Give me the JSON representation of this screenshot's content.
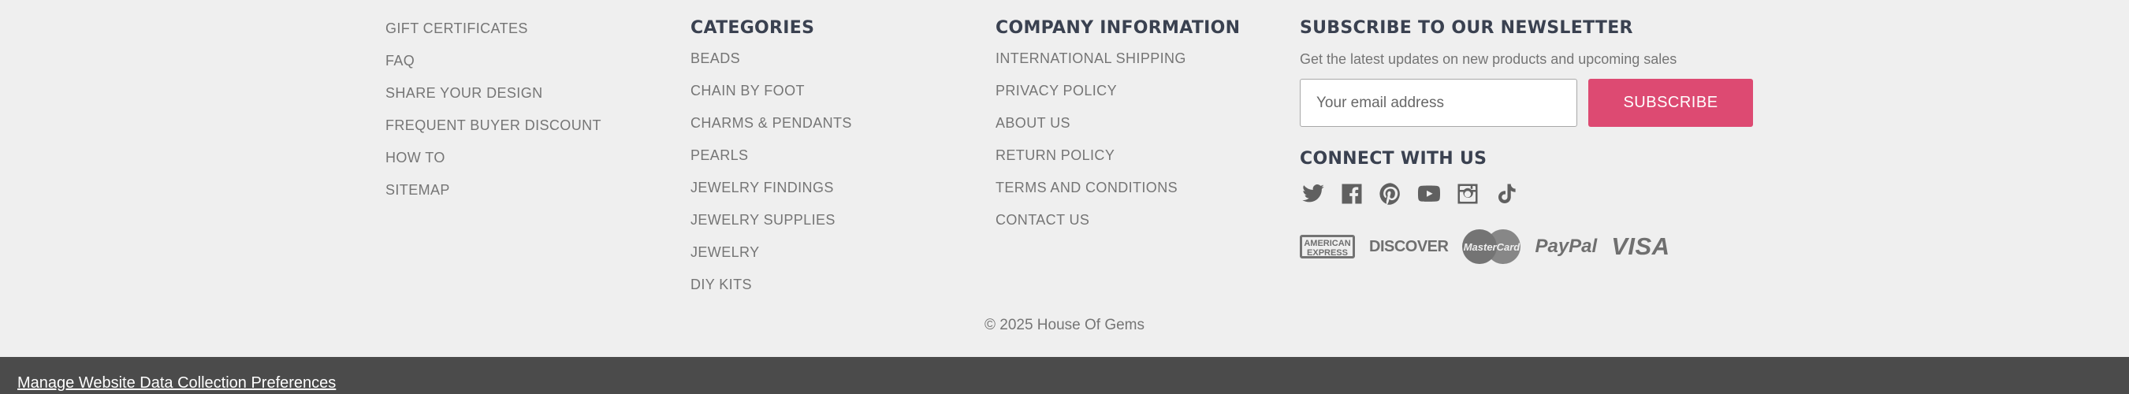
{
  "footer": {
    "col1": {
      "links": [
        "GIFT CERTIFICATES",
        "FAQ",
        "SHARE YOUR DESIGN",
        "FREQUENT BUYER DISCOUNT",
        "HOW TO",
        "SITEMAP"
      ]
    },
    "categories": {
      "heading": "CATEGORIES",
      "links": [
        "BEADS",
        "CHAIN BY FOOT",
        "CHARMS & PENDANTS",
        "PEARLS",
        "JEWELRY FINDINGS",
        "JEWELRY SUPPLIES",
        "JEWELRY",
        "DIY KITS"
      ]
    },
    "company": {
      "heading": "COMPANY INFORMATION",
      "links": [
        "INTERNATIONAL SHIPPING",
        "PRIVACY POLICY",
        "ABOUT US",
        "RETURN POLICY",
        "TERMS AND CONDITIONS",
        "CONTACT US"
      ]
    },
    "newsletter": {
      "heading": "SUBSCRIBE TO OUR NEWSLETTER",
      "text": "Get the latest updates on new products and upcoming sales",
      "email_placeholder": "Your email address",
      "subscribe_label": "SUBSCRIBE",
      "button_color": "#dd4a72"
    },
    "connect": {
      "heading": "CONNECT WITH US",
      "icons": [
        "twitter-icon",
        "facebook-icon",
        "pinterest-icon",
        "youtube-icon",
        "instagram-icon",
        "tiktok-icon"
      ]
    },
    "payments": {
      "amex": "AMERICAN EXPRESS",
      "discover": "DISCOVER",
      "mastercard": "MasterCard",
      "paypal": "PayPal",
      "visa": "VISA"
    },
    "copyright": "© 2025 House Of Gems"
  },
  "bottom_bar": {
    "manage_link": "Manage Website Data Collection Preferences",
    "background": "#4b4b4b"
  }
}
